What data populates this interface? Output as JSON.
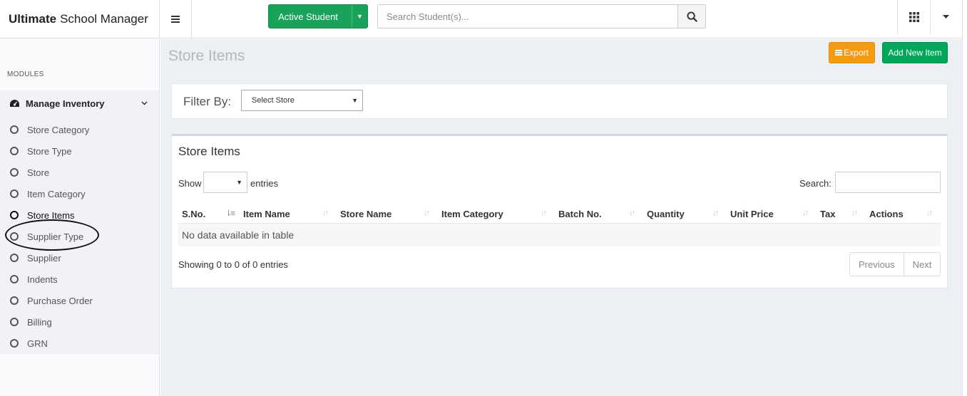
{
  "app": {
    "brand_bold": "Ultimate",
    "brand_rest": "School Manager"
  },
  "header": {
    "active_student_label": "Active Student",
    "search_placeholder": "Search Student(s)...",
    "icons": [
      "menu-icon",
      "caret-down-icon",
      "search-icon",
      "grid-icon",
      "caret-down-icon"
    ]
  },
  "sidebar": {
    "modules_label": "MODULES",
    "section": {
      "label": "Manage Inventory",
      "icon": "dashboard-icon",
      "chevron": "chevron-down-icon"
    },
    "items": [
      {
        "label": "Store Category"
      },
      {
        "label": "Store Type"
      },
      {
        "label": "Store"
      },
      {
        "label": "Item Category"
      },
      {
        "label": "Store Items",
        "active": true
      },
      {
        "label": "Supplier Type"
      },
      {
        "label": "Supplier"
      },
      {
        "label": "Indents"
      },
      {
        "label": "Purchase Order"
      },
      {
        "label": "Billing"
      },
      {
        "label": "GRN"
      }
    ]
  },
  "main": {
    "page_title": "Store Items",
    "export_label": "Export",
    "add_label": "Add New Item",
    "filter": {
      "label": "Filter By:",
      "store_select": "Select Store"
    },
    "table_box": {
      "title": "Store Items",
      "show_label": "Show",
      "entries_label": "entries",
      "entries_value": "",
      "search_label": "Search:",
      "search_value": "",
      "columns": [
        "S.No.",
        "Item Name",
        "Store Name",
        "Item Category",
        "Batch No.",
        "Quantity",
        "Unit Price",
        "Tax",
        "Actions"
      ],
      "empty_message": "No data available in table",
      "showing_text": "Showing 0 to 0 of 0 entries",
      "pagination": {
        "previous": "Previous",
        "next": "Next"
      }
    }
  },
  "colors": {
    "green": "#19a35a",
    "orange": "#f39c12",
    "add_green": "#00a65a",
    "content_bg": "#ecf0f5",
    "page_title": "#b3b8bd"
  }
}
